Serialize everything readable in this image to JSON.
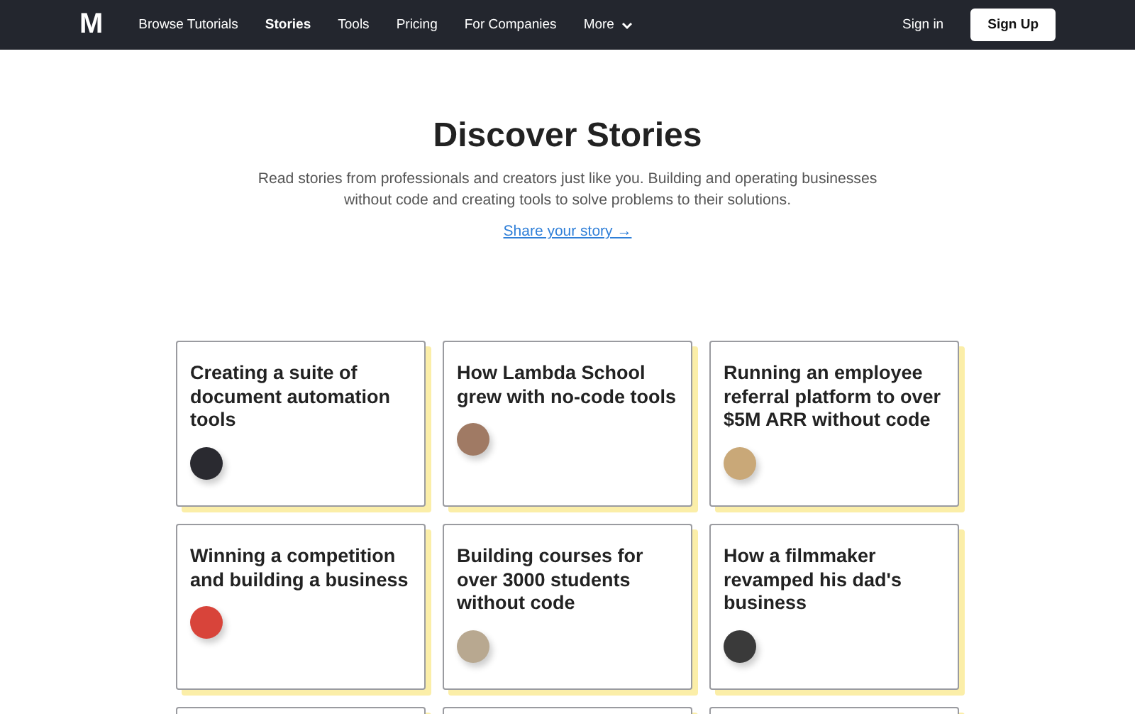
{
  "nav": {
    "logo": "M",
    "items": [
      {
        "label": "Browse Tutorials",
        "selected": false
      },
      {
        "label": "Stories",
        "selected": true
      },
      {
        "label": "Tools",
        "selected": false
      },
      {
        "label": "Pricing",
        "selected": false
      },
      {
        "label": "For Companies",
        "selected": false
      },
      {
        "label": "More",
        "selected": false,
        "kind": "dropdown"
      }
    ],
    "sign_in": "Sign in",
    "sign_up": "Sign Up"
  },
  "hero": {
    "title": "Discover Stories",
    "subtitle": "Read stories from professionals and creators just like you. Building and operating businesses without code and creating tools to solve problems to their solutions.",
    "link": "Share your story →"
  },
  "stories": [
    {
      "title": "Creating a suite of document automation tools",
      "color": "#2a2a30"
    },
    {
      "title": "How Lambda School grew with no-code tools",
      "color": "#a07a64"
    },
    {
      "title": "Running an employee referral platform to over $5M ARR without code",
      "color": "#c9a878"
    },
    {
      "title": "Winning a competition and building a business",
      "color": "#d8443a"
    },
    {
      "title": "Building courses for over 3000 students without code",
      "color": "#b8a890"
    },
    {
      "title": "How a filmmaker revamped his dad's business",
      "color": "#3a3a3a"
    }
  ]
}
